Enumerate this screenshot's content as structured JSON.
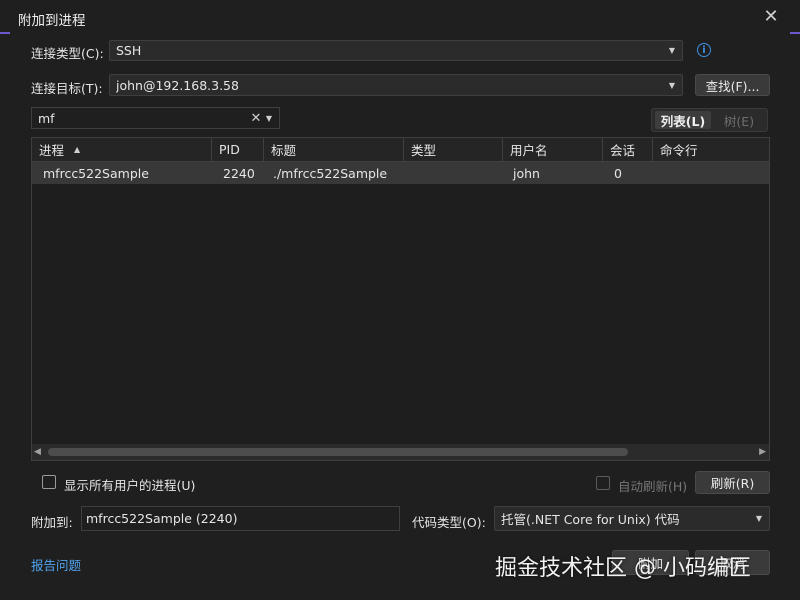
{
  "window": {
    "title": "附加到进程"
  },
  "connection": {
    "type_label": "连接类型(C):",
    "type_value": "SSH",
    "target_label": "连接目标(T):",
    "target_value": "john@192.168.3.58",
    "find_button": "查找(F)..."
  },
  "filter": {
    "value": "mf"
  },
  "view": {
    "list_label": "列表(L)",
    "tree_label": "树(E)"
  },
  "table": {
    "columns": [
      "进程",
      "PID",
      "标题",
      "类型",
      "用户名",
      "会话",
      "命令行"
    ],
    "rows": [
      {
        "process": "mfrcc522Sample",
        "pid": "2240",
        "title": "./mfrcc522Sample",
        "type": "",
        "user": "john",
        "session": "0",
        "cmdline": ""
      }
    ]
  },
  "options": {
    "show_all_users": "显示所有用户的进程(U)",
    "auto_refresh": "自动刷新(H)",
    "refresh_button": "刷新(R)"
  },
  "attach": {
    "label": "附加到:",
    "value": "mfrcc522Sample (2240)",
    "code_type_label": "代码类型(O):",
    "code_type_value": "托管(.NET Core for Unix) 代码"
  },
  "footer": {
    "report_link": "报告问题",
    "attach_button": "附加",
    "cancel_button": "取消"
  },
  "watermark": "掘金技术社区 @ 小码编匠",
  "colors": {
    "background": "#1f1f1f",
    "accent": "#3d8fe0",
    "link": "#4fa3f0",
    "selected_row": "#383838"
  }
}
